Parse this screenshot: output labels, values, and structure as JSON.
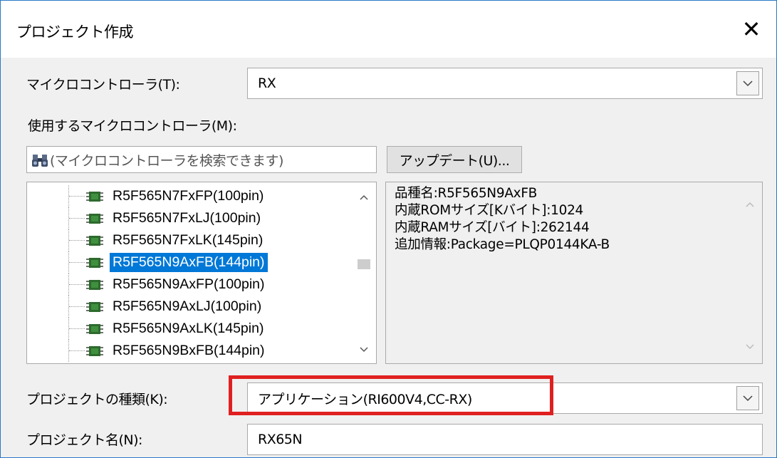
{
  "window": {
    "title": "プロジェクト作成",
    "close_label": "✕"
  },
  "mcu": {
    "label": "マイクロコントローラ(T):",
    "value": "RX"
  },
  "mcu_list": {
    "label": "使用するマイクロコントローラ(M):",
    "search_placeholder": "(マイクロコントローラを検索できます)",
    "update_button": "アップデート(U)...",
    "items": [
      {
        "label": "R5F565N7FxFP(100pin)",
        "selected": false
      },
      {
        "label": "R5F565N7FxLJ(100pin)",
        "selected": false
      },
      {
        "label": "R5F565N7FxLK(145pin)",
        "selected": false
      },
      {
        "label": "R5F565N9AxFB(144pin)",
        "selected": true
      },
      {
        "label": "R5F565N9AxFP(100pin)",
        "selected": false
      },
      {
        "label": "R5F565N9AxLJ(100pin)",
        "selected": false
      },
      {
        "label": "R5F565N9AxLK(145pin)",
        "selected": false
      },
      {
        "label": "R5F565N9BxFB(144pin)",
        "selected": false
      }
    ]
  },
  "details": {
    "line1": "品種名:R5F565N9AxFB",
    "line2": "内蔵ROMサイズ[Kバイト]:1024",
    "line3": "内蔵RAMサイズ[バイト]:262144",
    "line4": "追加情報:Package=PLQP0144KA-B"
  },
  "project_type": {
    "label": "プロジェクトの種類(K):",
    "value": "アプリケーション(RI600V4,CC-RX)"
  },
  "project_name": {
    "label": "プロジェクト名(N):",
    "value": "RX65N"
  },
  "icons": {
    "close": "close-icon",
    "dropdown": "chevron-down-icon",
    "search": "binoculars-icon",
    "chip": "chip-icon"
  },
  "colors": {
    "selection": "#0078d7",
    "highlight": "#e02020",
    "window_border": "#2a78c8"
  }
}
